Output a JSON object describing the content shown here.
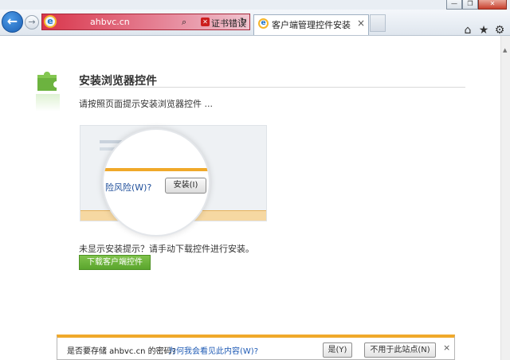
{
  "browser": {
    "address": "ahbvc.cn",
    "address_search_glyph": "⌕",
    "cert_error": "证书错误",
    "refresh_glyph": "↻",
    "back_glyph": "←",
    "forward_glyph": "→",
    "tab_title": "客户端管理控件安装",
    "tab_close": "×",
    "tools": {
      "home": "⌂",
      "favorites": "★",
      "settings": "⚙"
    },
    "window": {
      "minimize": "—",
      "restore": "❐",
      "close": "✕"
    }
  },
  "page": {
    "heading": "安装浏览器控件",
    "instruction": "请按照页面提示安装浏览器控件 ...",
    "illustration": {
      "risk_text": "险风险(W)?",
      "install_button": "安装(I)"
    },
    "not_shown_text": "未显示安装提示？请手动下载控件进行安装。",
    "download_button": "下载客户端控件"
  },
  "notification": {
    "question": "是否要存储 ahbvc.cn 的密码?",
    "why_link": "为何我会看见此内容(W)?",
    "yes_button": "是(Y)",
    "no_button": "不用于此站点(N)",
    "close": "×"
  },
  "colors": {
    "accent_green": "#5aa52d",
    "notification_orange": "#f0a92a",
    "address_bar_red": "#d9364b"
  }
}
